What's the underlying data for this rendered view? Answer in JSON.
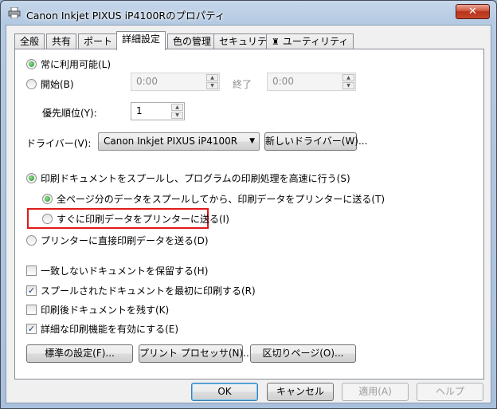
{
  "window": {
    "title": "Canon Inkjet PIXUS iP4100Rのプロパティ",
    "close": "✕"
  },
  "tabs": [
    {
      "label": "全般"
    },
    {
      "label": "共有"
    },
    {
      "label": "ポート"
    },
    {
      "label": "詳細設定"
    },
    {
      "label": "色の管理"
    },
    {
      "label": "セキュリティ"
    },
    {
      "label": "ユーティリティ"
    }
  ],
  "availability": {
    "always": "常に利用可能(L)",
    "from": "開始(B)",
    "from_time": "0:00",
    "to_label": "終了",
    "to_time": "0:00"
  },
  "priority": {
    "label": "優先順位(Y):",
    "value": "1"
  },
  "driver": {
    "label": "ドライバー(V):",
    "selected": "Canon Inkjet PIXUS iP4100R",
    "new_button": "新しいドライバー(W)..."
  },
  "spool": {
    "spool_option": "印刷ドキュメントをスプールし、プログラムの印刷処理を高速に行う(S)",
    "after_last_page": "全ページ分のデータをスプールしてから、印刷データをプリンターに送る(T)",
    "immediately": "すぐに印刷データをプリンターに送る(I)",
    "direct": "プリンターに直接印刷データを送る(D)"
  },
  "options": [
    {
      "label": "一致しないドキュメントを保留する(H)",
      "checked": false
    },
    {
      "label": "スプールされたドキュメントを最初に印刷する(R)",
      "checked": true
    },
    {
      "label": "印刷後ドキュメントを残す(K)",
      "checked": false
    },
    {
      "label": "詳細な印刷機能を有効にする(E)",
      "checked": true
    }
  ],
  "buttons": {
    "defaults": "標準の設定(F)...",
    "processor": "プリント プロセッサ(N)...",
    "separator": "区切りページ(O)...",
    "ok": "OK",
    "cancel": "キャンセル",
    "apply": "適用(A)",
    "help": "ヘルプ"
  }
}
